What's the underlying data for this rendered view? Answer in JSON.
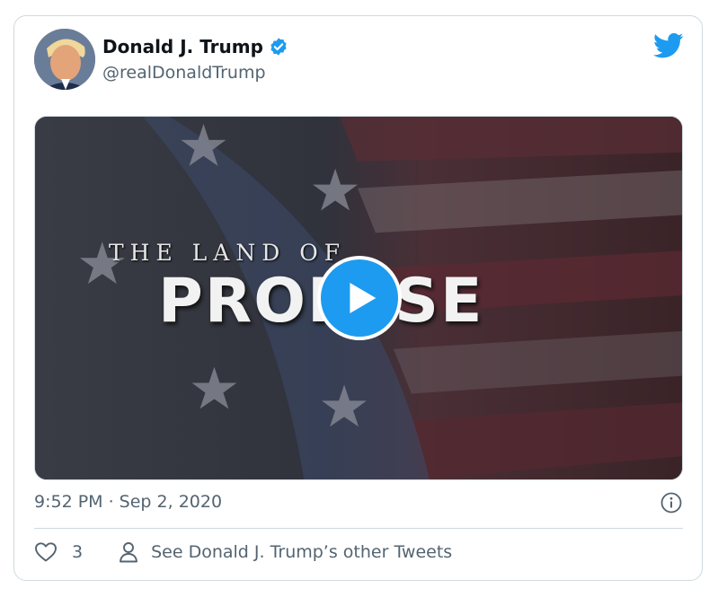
{
  "tweet": {
    "author_name": "Donald J. Trump",
    "handle": "@realDonaldTrump",
    "timestamp": "9:52 PM · Sep 2, 2020",
    "like_count": "3",
    "other_tweets_link": "See Donald J. Trump’s other Tweets"
  },
  "media": {
    "title_line1": "THE LAND OF",
    "title_line2": "PROMISE"
  },
  "icons": {
    "verified": "verified-badge-icon",
    "logo": "twitter-bird-icon",
    "play": "play-icon",
    "info": "info-icon",
    "like": "heart-icon",
    "profile": "person-icon"
  },
  "colors": {
    "accent": "#1d9bf0",
    "text_primary": "#0f1419",
    "text_secondary": "#536471",
    "border": "#cfd9de"
  }
}
